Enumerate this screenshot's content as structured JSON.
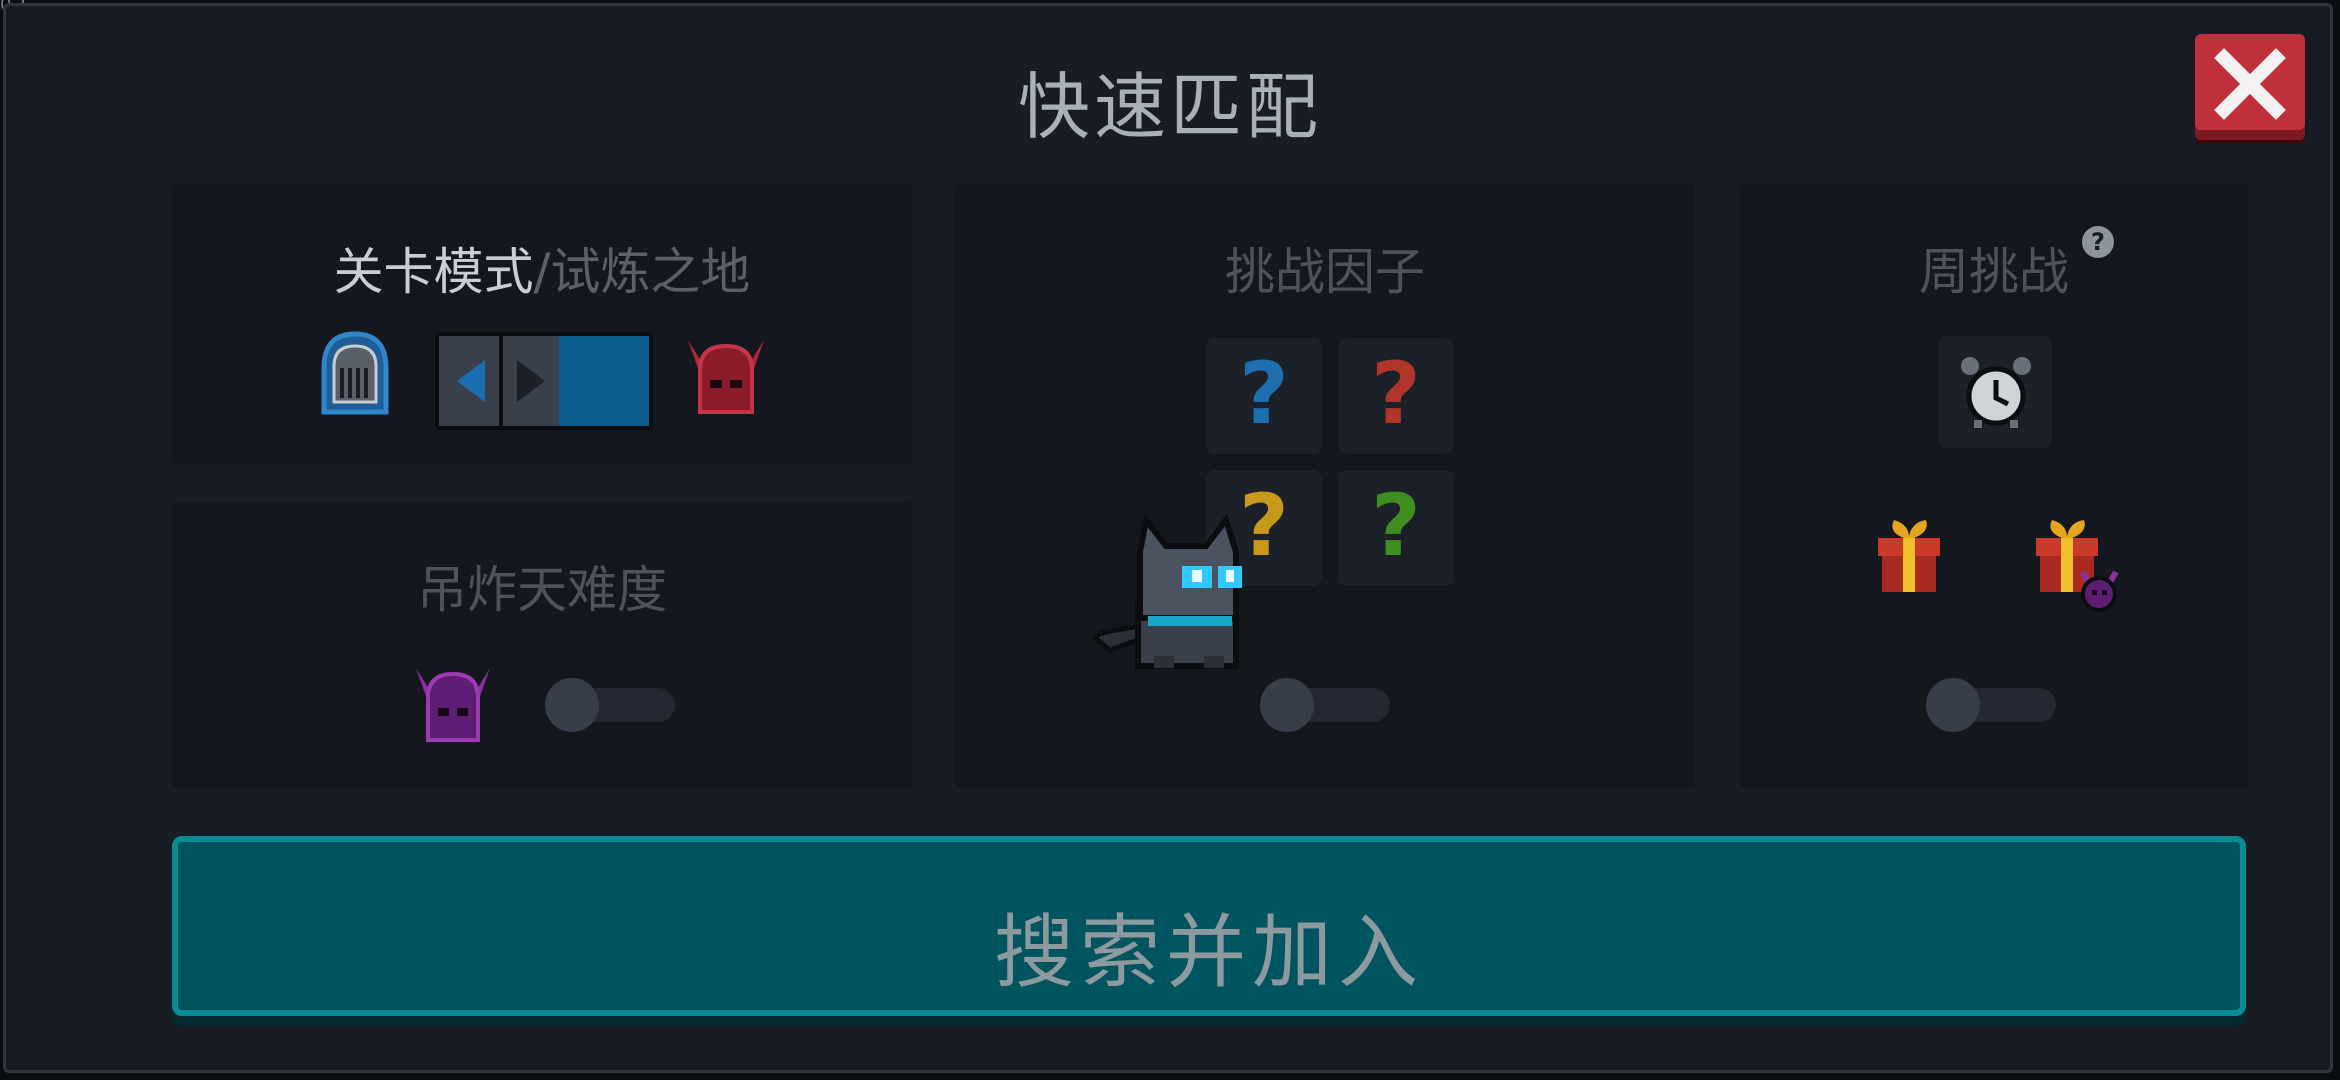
{
  "version": "0.1",
  "title": "快速匹配",
  "close_label": "✕",
  "mode_panel": {
    "primary": "关卡模式",
    "separator": "/",
    "secondary": "试炼之地"
  },
  "difficulty_panel": {
    "title": "吊炸天难度"
  },
  "factors_panel": {
    "title": "挑战因子",
    "slots": [
      "?",
      "?",
      "?",
      "?"
    ]
  },
  "weekly_panel": {
    "title": "周挑战",
    "help": "?"
  },
  "search_button": "搜索并加入",
  "colors": {
    "accent": "#0a8a92",
    "close": "#c0313c",
    "q_blue": "#1d6fb0",
    "q_red": "#b0362a",
    "q_yellow": "#c7991a",
    "q_green": "#3f8f1e",
    "cat_eyes": "#33c8ff"
  }
}
